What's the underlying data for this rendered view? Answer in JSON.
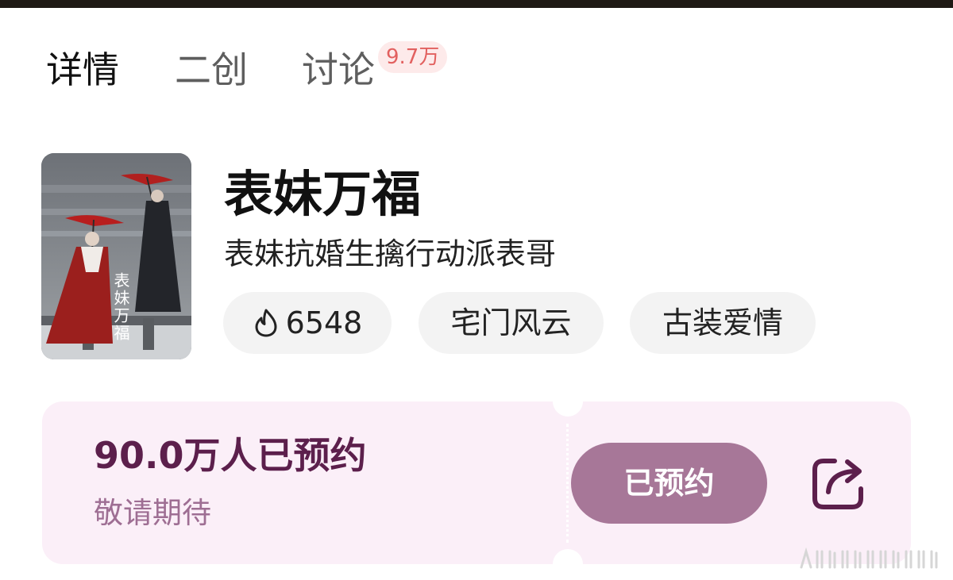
{
  "tabs": [
    {
      "label": "详情",
      "active": true
    },
    {
      "label": "二创",
      "active": false
    },
    {
      "label": "讨论",
      "active": false,
      "badge": "9.7万"
    }
  ],
  "show": {
    "title": "表妹万福",
    "subtitle": "表妹抗婚生擒行动派表哥",
    "tags": [
      {
        "label": "6548",
        "icon": "flame-icon"
      },
      {
        "label": "宅门风云"
      },
      {
        "label": "古装爱情"
      }
    ],
    "poster": {
      "calligraphy": "表妹万福"
    }
  },
  "reservation": {
    "count_text": "90.0万人已预约",
    "hint": "敬请期待",
    "button_label": "已预约",
    "share_icon": "share-icon"
  },
  "colors": {
    "accent": "#a77798",
    "count": "#5c1f4c",
    "hint": "#9e6e93",
    "ticket_bg": "#fbeff8",
    "badge_bg": "#fdeaea",
    "badge_text": "#e2605f",
    "tag_bg": "#f3f3f3"
  }
}
